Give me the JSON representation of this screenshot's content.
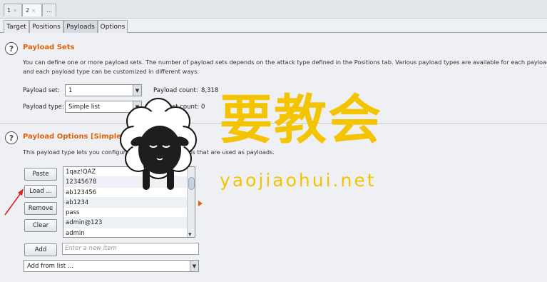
{
  "top_tabs": [
    {
      "label": "1",
      "close": "×"
    },
    {
      "label": "2",
      "close": "×"
    },
    {
      "label": "..."
    }
  ],
  "sub_tabs": [
    "Target",
    "Positions",
    "Payloads",
    "Options"
  ],
  "payload_sets": {
    "title": "Payload Sets",
    "description_line1": "You can define one or more payload sets. The number of payload sets depends on the attack type defined in the Positions tab. Various payload types are available for each payload set,",
    "description_line2": "and each payload type can be customized in different ways.",
    "payload_set_label": "Payload set:",
    "payload_set_value": "1",
    "payload_count_label": "Payload count:",
    "payload_count_value": "8,318",
    "payload_type_label": "Payload type:",
    "payload_type_value": "Simple list",
    "request_count_label": "Request count:",
    "request_count_value": "0"
  },
  "payload_options": {
    "title": "Payload Options [Simple list]",
    "description": "This payload type lets you configure a simple list of strings that are used as payloads.",
    "buttons": {
      "paste": "Paste",
      "load": "Load ...",
      "remove": "Remove",
      "clear": "Clear",
      "add": "Add"
    },
    "list_items": [
      "1qaz!QAZ",
      "12345678",
      "ab123456",
      "ab1234",
      "pass",
      "admin@123",
      "admin"
    ],
    "new_item_placeholder": "Enter a new item",
    "add_from_list": "Add from list ..."
  },
  "watermark": {
    "chinese": "要教会",
    "url": "yaojiaohui.net"
  },
  "colors": {
    "section_title": "#e2620d",
    "watermark": "#f5c400",
    "annotation_arrow": "#e02020"
  }
}
